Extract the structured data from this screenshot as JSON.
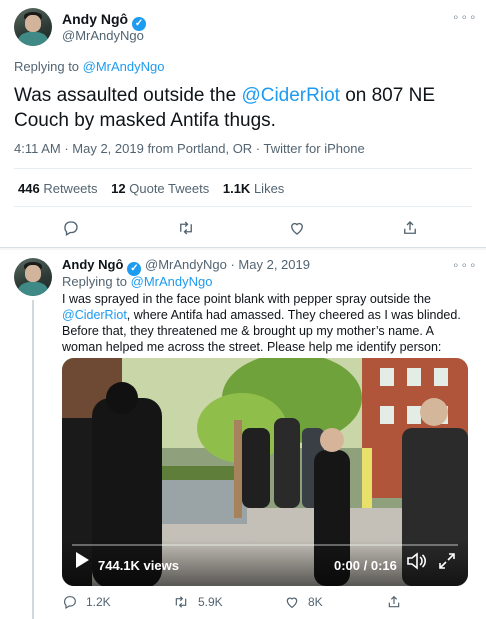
{
  "main_tweet": {
    "author_name": "Andy Ngô",
    "handle": "@MrAndyNgo",
    "replying_prefix": "Replying to ",
    "replying_handle": "@MrAndyNgo",
    "text_before": "Was assaulted outside the ",
    "text_mention": "@CiderRiot",
    "text_after": " on 807 NE Couch by masked Antifa thugs.",
    "timestamp": "4:11 AM · May 2, 2019 from Portland, OR · Twitter for iPhone",
    "stats": {
      "retweets_count": "446",
      "retweets_label": "Retweets",
      "quotes_count": "12",
      "quotes_label": "Quote Tweets",
      "likes_count": "1.1K",
      "likes_label": "Likes"
    }
  },
  "reply_tweet": {
    "author_name": "Andy Ngô",
    "handle": "@MrAndyNgo",
    "date": "· May 2, 2019",
    "replying_prefix": "Replying to ",
    "replying_handle": "@MrAndyNgo",
    "text_1": "I was sprayed in the face point blank with pepper spray outside the",
    "text_mention": "@CiderRiot",
    "text_2": ", where Antifa had amassed. They cheered as I was blinded.",
    "text_3": "Before that, they threatened me & brought up my mother’s name. A",
    "text_4": "woman helped me across the street. Please help me identify person:",
    "video": {
      "views": "744.1K views",
      "time": "0:00 / 0:16",
      "progress": 0
    },
    "actions": {
      "reply_count": "1.2K",
      "retweet_count": "5.9K",
      "like_count": "8K"
    }
  },
  "icons": [
    "verified-icon",
    "more-icon",
    "reply-icon",
    "retweet-icon",
    "like-icon",
    "share-icon",
    "play-icon",
    "volume-icon",
    "fullscreen-icon"
  ],
  "colors": {
    "accent": "#1d9bf0",
    "text": "#0f1419",
    "muted": "#536471",
    "divider": "#e6ecf0"
  }
}
